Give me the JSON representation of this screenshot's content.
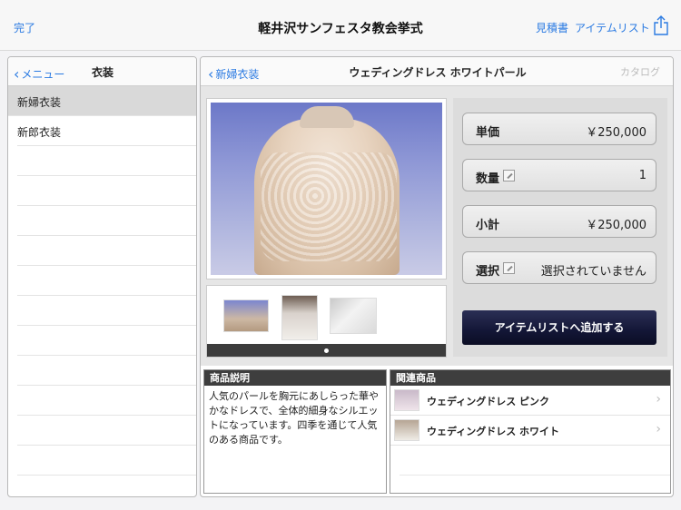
{
  "topbar": {
    "done_label": "完了",
    "title": "軽井沢サンフェスタ教会挙式",
    "estimate_label": "見積書",
    "item_list_label": "アイテムリスト"
  },
  "sidebar": {
    "back_label": "メニュー",
    "title": "衣装",
    "items": [
      {
        "label": "新婦衣装",
        "selected": true
      },
      {
        "label": "新郎衣装",
        "selected": false
      }
    ]
  },
  "detail": {
    "back_label": "新婦衣装",
    "title": "ウェディングドレス ホワイトパール",
    "catalog_label": "カタログ",
    "price_label": "単価",
    "price_value": "￥250,000",
    "quantity_label": "数量",
    "quantity_value": "1",
    "subtotal_label": "小計",
    "subtotal_value": "￥250,000",
    "select_label": "選択",
    "select_value": "選択されていません",
    "add_button_label": "アイテムリストへ追加する",
    "gallery_page": 1,
    "gallery_pages": 1
  },
  "description": {
    "header": "商品説明",
    "text": "人気のパールを胸元にあしらった華やかなドレスで、全体的細身なシルエットになっています。四季を通じて人気のある商品です。"
  },
  "related": {
    "header": "関連商品",
    "items": [
      {
        "label": "ウェディングドレス ピンク"
      },
      {
        "label": "ウェディングドレス ホワイト"
      }
    ]
  },
  "colors": {
    "accent": "#2a7ae2",
    "button_dark": "#131636",
    "section_header": "#3e3e3e"
  }
}
